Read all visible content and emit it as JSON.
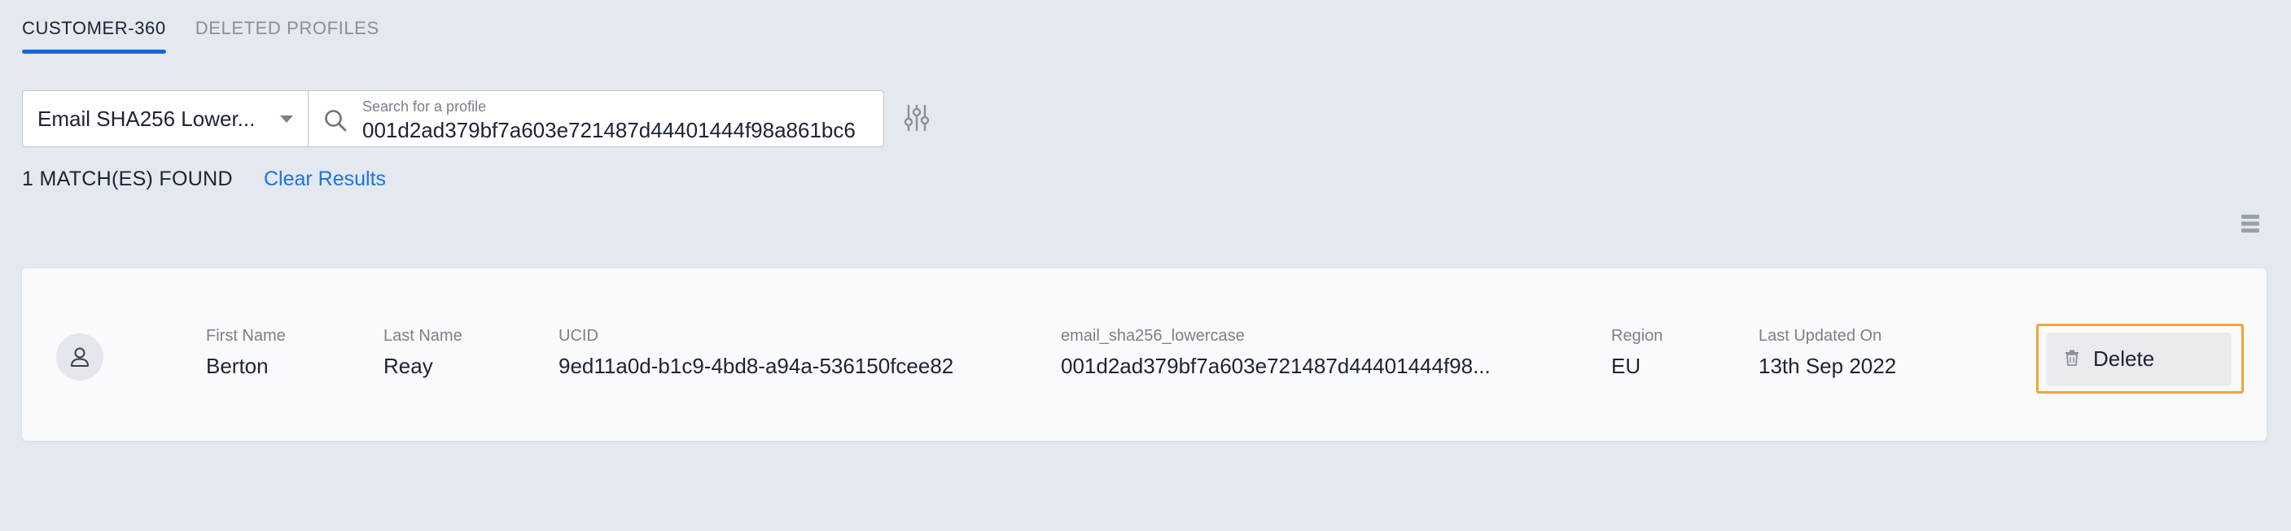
{
  "tabs": [
    {
      "label": "CUSTOMER-360",
      "active": true
    },
    {
      "label": "DELETED PROFILES",
      "active": false
    }
  ],
  "search": {
    "type_selected": "Email SHA256 Lower...",
    "label": "Search for a profile",
    "value": "001d2ad379bf7a603e721487d44401444f98a861bc6"
  },
  "results": {
    "count_text": "1 MATCH(ES) FOUND",
    "clear_label": "Clear Results"
  },
  "profile": {
    "fields": [
      {
        "label": "First Name",
        "value": "Berton"
      },
      {
        "label": "Last Name",
        "value": "Reay"
      },
      {
        "label": "UCID",
        "value": "9ed11a0d-b1c9-4bd8-a94a-536150fcee82"
      },
      {
        "label": "email_sha256_lowercase",
        "value": "001d2ad379bf7a603e721487d44401444f98..."
      },
      {
        "label": "Region",
        "value": "EU"
      },
      {
        "label": "Last Updated On",
        "value": "13th Sep 2022"
      }
    ],
    "delete_label": "Delete"
  },
  "icons": {
    "search": "search-icon",
    "filter": "sliders-icon",
    "menu": "list-view-icon",
    "avatar": "user-icon",
    "delete": "trash-icon"
  },
  "colors": {
    "background": "#e4e8ef",
    "accent": "#1565d8",
    "link": "#1a73e8",
    "highlight": "#f2a53a",
    "card": "#fafbfc"
  }
}
